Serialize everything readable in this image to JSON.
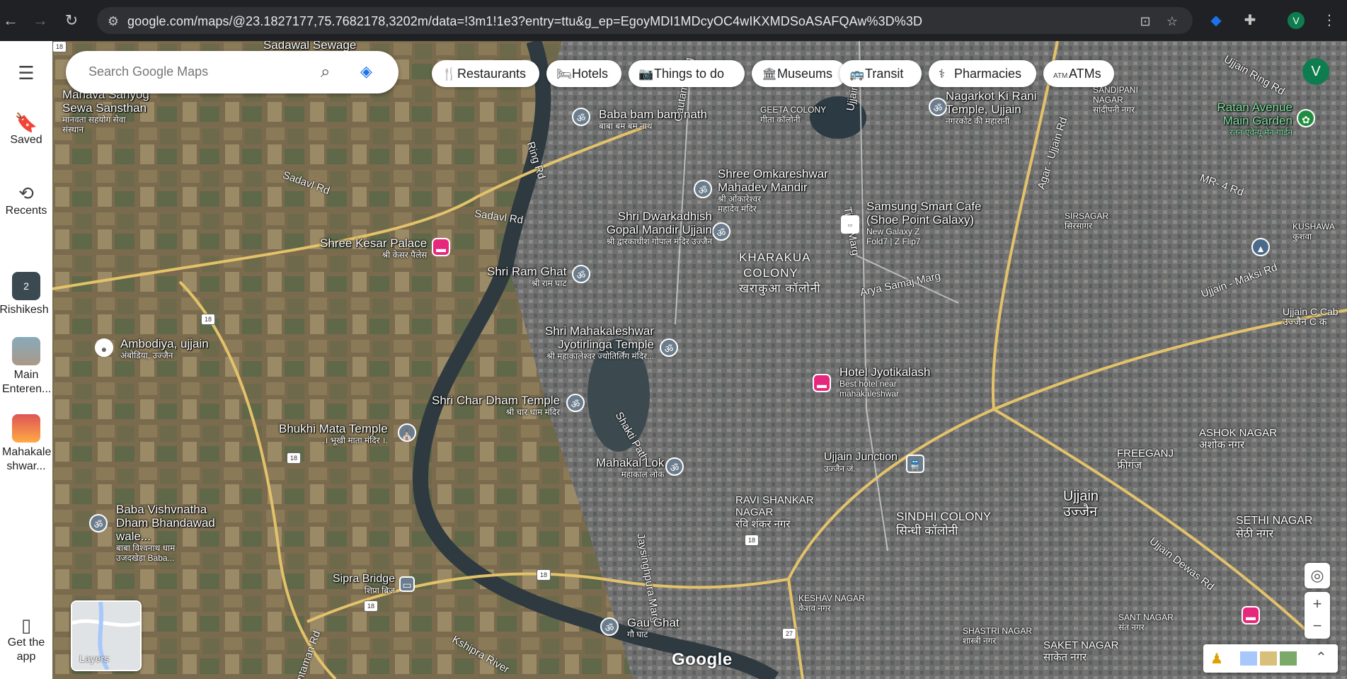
{
  "browser": {
    "url": "google.com/maps/@23.1827177,75.7682178,3202m/data=!3m1!1e3?entry=ttu&g_ep=EgoyMDI1MDcyOC4wIKXMDSoASAFQAw%3D%3D",
    "profile_initial": "V"
  },
  "rail": {
    "saved": "Saved",
    "recents": "Recents",
    "recent_items": [
      {
        "label": "Rishikesh",
        "badge": "2"
      },
      {
        "label": "Main Enteren..."
      },
      {
        "label": "Mahakale shwar..."
      }
    ],
    "get_app": "Get the app"
  },
  "search": {
    "placeholder": "Search Google Maps"
  },
  "chips": [
    "Restaurants",
    "Hotels",
    "Things to do",
    "Museums",
    "Transit",
    "Pharmacies",
    "ATMs"
  ],
  "account_initial": "V",
  "layers_label": "Layers",
  "google_logo": "Google",
  "map": {
    "places": [
      {
        "name": "Baba bam bam nath",
        "sub": "बाबा बम बम नाथ"
      },
      {
        "name": "Nagarkot Ki Rani Temple, Ujjain",
        "sub": "नगरकोट की महारानी"
      },
      {
        "name": "Shree Omkareshwar Mahadev Mandir",
        "sub": "श्री ओंकारेश्वर महादेव मंदिर"
      },
      {
        "name": "Shri Dwarkadhish Gopal Mandir Ujjain",
        "sub": "श्री द्वारकाधीश गोपाल मंदिर उज्जैन"
      },
      {
        "name": "Samsung Smart Cafe (Shoe Point Galaxy)",
        "sub": "New Galaxy Z Fold7 | Z Flip7"
      },
      {
        "name": "Shree Kesar Palace",
        "sub": "श्री केसर पैलेस"
      },
      {
        "name": "Shri Ram Ghat",
        "sub": "श्री राम घाट"
      },
      {
        "name": "Shri Mahakaleshwar Jyotirlinga Temple",
        "sub": "श्री महाकालेश्वर ज्योतिर्लिंग मंदिर..."
      },
      {
        "name": "Ambodiya, ujjain",
        "sub": "अंबोडिया, उज्जैन"
      },
      {
        "name": "Hotel Jyotikalash",
        "sub": "Best hotel near mahakaleshwar"
      },
      {
        "name": "Shri Char Dham Temple",
        "sub": "श्री चार धाम मंदिर"
      },
      {
        "name": "Bhukhi Mata Temple",
        "sub": ".। भूखी माता मंदिर ।."
      },
      {
        "name": "Mahakal Lok",
        "sub": "महाकाल लोक"
      },
      {
        "name": "Ujjain Junction",
        "sub": "उज्जैन जं."
      },
      {
        "name": "Baba Vishvnatha Dham Bhandawad wale...",
        "sub": "बाबा विश्वनाथ धाम उजदखेड़ा Baba..."
      },
      {
        "name": "Sipra Bridge",
        "sub": "शिप्रा ब्रिज"
      },
      {
        "name": "Gau Ghat",
        "sub": "गौ घाट"
      },
      {
        "name": "Ratan Avenue Main Garden",
        "sub": "रतन एवेन्यू मेन गार्डन"
      },
      {
        "name": "Manava Sahyog Sewa Sansthan",
        "sub": "मानवता सहयोग सेवा संस्थान"
      },
      {
        "name": "Sadawal Sewage"
      }
    ],
    "areas": [
      {
        "name": "KHARAKUA COLONY",
        "sub": "खराकुआ कॉलोनी"
      },
      {
        "name": "GEETA COLONY",
        "sub": "गीता कॉलोनी"
      },
      {
        "name": "SANDIPANI NAGAR",
        "sub": "सांदीपनी नगर"
      },
      {
        "name": "SIRSAGAR",
        "sub": "सिरसागर"
      },
      {
        "name": "KUSHAWA",
        "sub": "कुशवा"
      },
      {
        "name": "ASHOK NAGAR",
        "sub": "अशोक नगर"
      },
      {
        "name": "FREEGANJ",
        "sub": "फ्रीगंज"
      },
      {
        "name": "Ujjain",
        "sub": "उज्जैन"
      },
      {
        "name": "RAVI SHANKAR NAGAR",
        "sub": "रवि शंकर नगर"
      },
      {
        "name": "SINDHI COLONY",
        "sub": "सिन्धी कॉलोनी"
      },
      {
        "name": "SETHI NAGAR",
        "sub": "सेठी नगर"
      },
      {
        "name": "KESHAV NAGAR",
        "sub": "केशव नगर"
      },
      {
        "name": "SANT NAGAR",
        "sub": "संत नगर"
      },
      {
        "name": "SHASTRI NAGAR",
        "sub": "शास्त्री नगर"
      },
      {
        "name": "SAKET NAGAR",
        "sub": "साकेत नगर"
      },
      {
        "name": "Ujjain C Cab",
        "sub": "उज्जैन C क"
      }
    ],
    "roads": [
      "Sadavl Rd",
      "Sadavl Rd",
      "Ring Rd",
      "Gautam Marg",
      "Ujjain Rd",
      "Tilak Marg",
      "Arya Samaj Marg",
      "Agar - Ujjain Rd",
      "MR- 4 Rd",
      "Ujjain - Maksi Rd",
      "Ujjain Dewas Rd",
      "Shakti Path",
      "Jaysinghpura Marg",
      "Kshipra River",
      "Chintaman Rd",
      "Ujjain Ring Rd"
    ],
    "route_shields": [
      "18",
      "18",
      "18",
      "18",
      "18",
      "18",
      "27"
    ]
  }
}
